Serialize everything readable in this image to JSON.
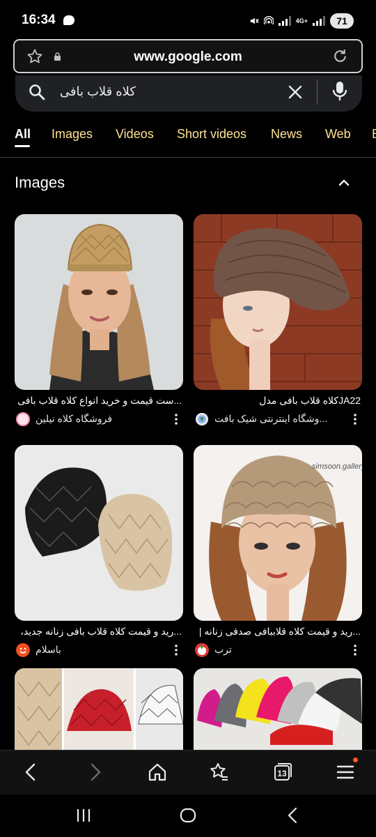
{
  "status_bar": {
    "time": "16:34",
    "network": "4G+",
    "battery": "71"
  },
  "browser": {
    "url": "www.google.com"
  },
  "search": {
    "query": "کلاه قلاب بافی"
  },
  "tabs": [
    {
      "label": "All",
      "active": true
    },
    {
      "label": "Images"
    },
    {
      "label": "Videos"
    },
    {
      "label": "Short videos"
    },
    {
      "label": "News"
    },
    {
      "label": "Web"
    },
    {
      "label": "B"
    }
  ],
  "images_section": {
    "title": "Images",
    "results": [
      {
        "caption": "...ست قیمت و خرید انواع کلاه قلاب بافی",
        "source": "فروشگاه کلاه نیلین",
        "favicon": "pink-logo-icon"
      },
      {
        "caption": "JA22کلاه قلاب بافی مدل",
        "source": "...وشگاه اینترنتی شیک بافت",
        "favicon": "globe-icon"
      },
      {
        "caption": "...رید و قیمت کلاه قلاب بافی زنانه جدید،",
        "source": "باسلام",
        "favicon": "orange-face-icon"
      },
      {
        "caption": "...رید و قیمت کلاه قلاببافی صدفی زنانه |",
        "source": "ترب",
        "favicon": "red-tomato-icon"
      },
      {
        "caption": "",
        "source": "",
        "favicon": ""
      },
      {
        "caption": "",
        "source": "",
        "favicon": ""
      }
    ],
    "watermark": "simsoon.gallery"
  },
  "bottom_nav": {
    "tab_count": "13"
  },
  "colors": {
    "tab_link": "#fde293",
    "background": "#000000",
    "accent_notification": "#ff5a1f"
  }
}
